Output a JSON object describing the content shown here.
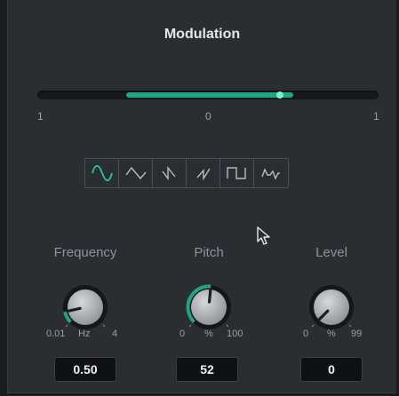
{
  "title": "Modulation",
  "slider": {
    "min_label": "1",
    "mid_label": "0",
    "max_label": "1",
    "range_start": -0.48,
    "range_end": 0.5,
    "thumb": 0.42
  },
  "waveforms": {
    "active_index": 0,
    "items": [
      {
        "icon": "sine-wave-icon"
      },
      {
        "icon": "triangle-wave-icon"
      },
      {
        "icon": "sawtooth-up-wave-icon"
      },
      {
        "icon": "sawtooth-down-wave-icon"
      },
      {
        "icon": "square-wave-icon"
      },
      {
        "icon": "random-wave-icon"
      }
    ]
  },
  "knobs": [
    {
      "label": "Frequency",
      "min": "0.01",
      "unit": "Hz",
      "max": "4",
      "value": "0.50",
      "fraction": 0.12
    },
    {
      "label": "Pitch",
      "min": "0",
      "unit": "%",
      "max": "100",
      "value": "52",
      "fraction": 0.52
    },
    {
      "label": "Level",
      "min": "0",
      "unit": "%",
      "max": "99",
      "value": "0",
      "fraction": 0.0
    }
  ],
  "colors": {
    "accent": "#1fa584",
    "accent_light": "#7df0cd",
    "panel": "#2a2d32"
  }
}
